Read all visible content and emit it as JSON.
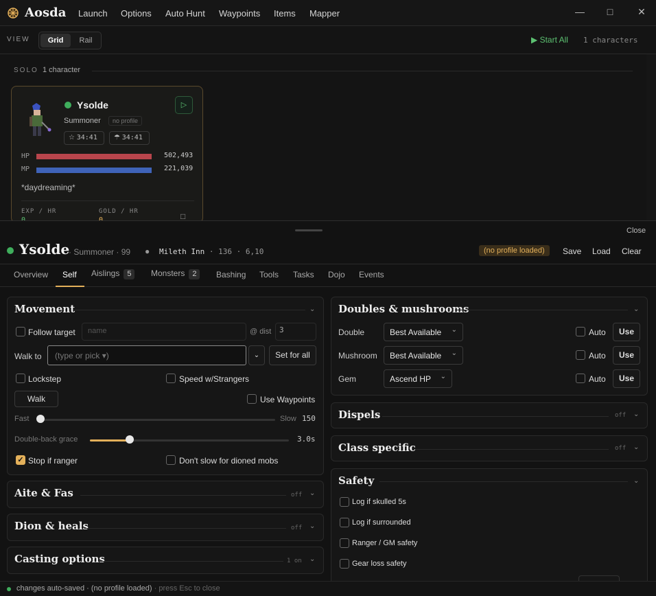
{
  "app": {
    "title": "Aosda"
  },
  "menu": [
    "Launch",
    "Options",
    "Auto Hunt",
    "Waypoints",
    "Items",
    "Mapper"
  ],
  "view": {
    "label": "VIEW",
    "options": [
      "Grid",
      "Rail"
    ],
    "selected": "Grid",
    "start_all": "Start All",
    "char_count": "1 characters"
  },
  "group": {
    "label": "SOLO",
    "count": "1 character"
  },
  "card": {
    "name": "Ysolde",
    "class": "Summoner",
    "profile": "no profile",
    "timer1": "34:41",
    "timer2": "34:41",
    "hp_label": "HP",
    "hp_value": "502,493",
    "hp_fraction": 1.0,
    "mp_label": "MP",
    "mp_value": "221,039",
    "mp_fraction": 1.0,
    "status": "*daydreaming*",
    "exp_label": "EXP / HR",
    "exp_value": "0",
    "gold_label": "GOLD / HR",
    "gold_value": "0"
  },
  "detail": {
    "close": "Close",
    "name": "Ysolde",
    "class": "Summoner",
    "level": "99",
    "map": "Mileth Inn",
    "map_id": "136",
    "coords": "6,10",
    "profile_status": "(no profile loaded)",
    "save": "Save",
    "load": "Load",
    "clear": "Clear"
  },
  "tabs": [
    {
      "label": "Overview"
    },
    {
      "label": "Self"
    },
    {
      "label": "Aislings",
      "badge": "5"
    },
    {
      "label": "Monsters",
      "badge": "2"
    },
    {
      "label": "Bashing"
    },
    {
      "label": "Tools"
    },
    {
      "label": "Tasks"
    },
    {
      "label": "Dojo"
    },
    {
      "label": "Events"
    }
  ],
  "active_tab": "Self",
  "movement": {
    "title": "Movement",
    "follow_target": "Follow target",
    "name_placeholder": "name",
    "dist_label": "@ dist",
    "dist_value": "3",
    "walk_to": "Walk to",
    "walk_placeholder": "(type or pick ▾)",
    "set_for_all": "Set for all",
    "lockstep": "Lockstep",
    "speed_strangers": "Speed w/Strangers",
    "walk": "Walk",
    "use_waypoints": "Use Waypoints",
    "fast": "Fast",
    "slow": "Slow",
    "speed_value": "150",
    "speed_fraction": 0.0,
    "doubleback": "Double-back grace",
    "doubleback_value": "3.0s",
    "doubleback_fraction": 0.2,
    "stop_ranger": "Stop if ranger",
    "stop_ranger_checked": true,
    "dont_slow": "Don't slow for dioned mobs"
  },
  "aite": {
    "title": "Aite & Fas",
    "status": "off"
  },
  "dion": {
    "title": "Dion & heals",
    "status": "off"
  },
  "casting": {
    "title": "Casting options",
    "status": "1 on"
  },
  "doubles": {
    "title": "Doubles & mushrooms",
    "rows": [
      {
        "label": "Double",
        "value": "Best Available",
        "auto": "Auto",
        "use": "Use"
      },
      {
        "label": "Mushroom",
        "value": "Best Available",
        "auto": "Auto",
        "use": "Use"
      },
      {
        "label": "Gem",
        "value": "Ascend HP",
        "auto": "Auto",
        "use": "Use"
      }
    ]
  },
  "dispels": {
    "title": "Dispels",
    "status": "off"
  },
  "class_specific": {
    "title": "Class specific",
    "status": "off"
  },
  "safety": {
    "title": "Safety",
    "items": [
      "Log if skulled 5s",
      "Log if surrounded",
      "Ranger / GM safety",
      "Gear loss safety"
    ]
  },
  "footer": {
    "saved": "changes auto-saved",
    "profile": "(no profile loaded)",
    "esc": "press Esc to close"
  },
  "colors": {
    "accent": "#e3b05a",
    "online": "#3fae5c",
    "hp": "#b8454c",
    "mp": "#3f63b8",
    "start": "#5cc071"
  }
}
